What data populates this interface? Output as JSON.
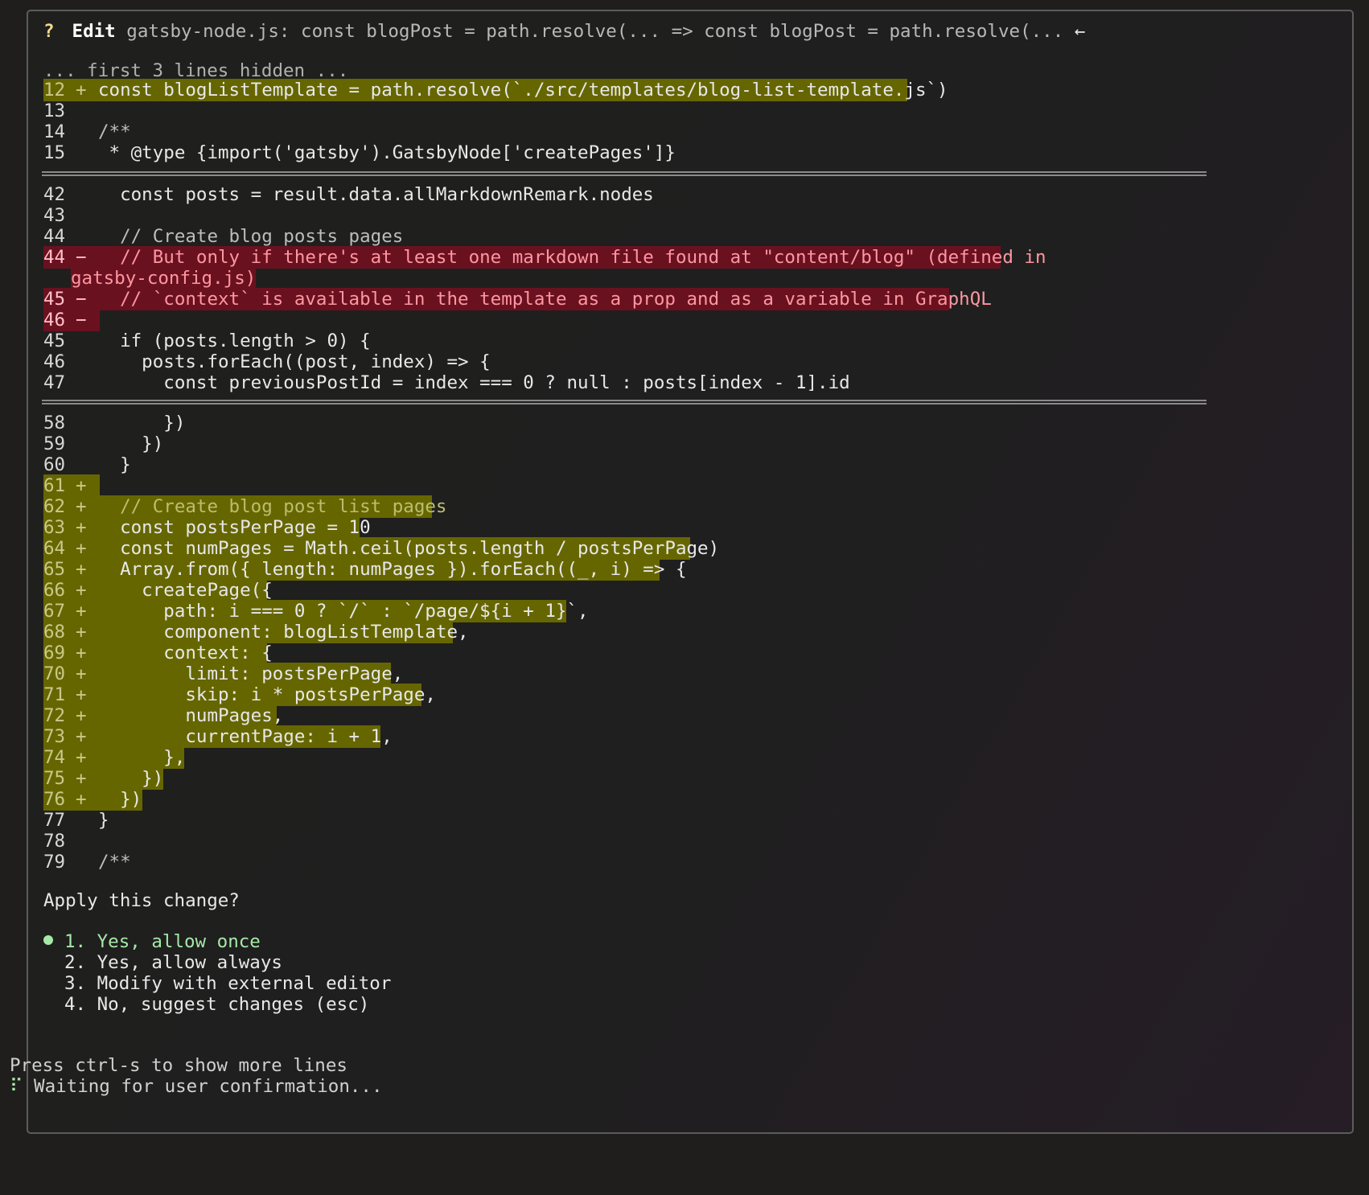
{
  "header": {
    "question_mark": "?",
    "action": "Edit",
    "description": "gatsby-node.js: const blogPost = path.resolve(... => const blogPost = path.resolve(...",
    "arrow": "←"
  },
  "diff": {
    "hidden_note": "... first 3 lines hidden ...",
    "hunk1": [
      {
        "num": "12",
        "mark": "+",
        "text": "const blogListTemplate = path.resolve(`./src/templates/blog-list-template.js`)",
        "kind": "add"
      },
      {
        "num": "13",
        "mark": "",
        "text": "",
        "kind": "ctx"
      },
      {
        "num": "14",
        "mark": "",
        "text": "/**",
        "kind": "ctx"
      },
      {
        "num": "15",
        "mark": "",
        "text": " * @type {import('gatsby').GatsbyNode['createPages']}",
        "kind": "ctx"
      }
    ],
    "hunk2": [
      {
        "num": "42",
        "mark": "",
        "text": "  const posts = result.data.allMarkdownRemark.nodes",
        "kind": "ctx"
      },
      {
        "num": "43",
        "mark": "",
        "text": "",
        "kind": "ctx"
      },
      {
        "num": "44",
        "mark": "",
        "text": "  // Create blog posts pages",
        "kind": "ctx"
      },
      {
        "num": "44",
        "mark": "−",
        "text": "  // But only if there's at least one markdown file found at \"content/blog\" (defined in",
        "kind": "del"
      },
      {
        "num": "",
        "mark": "",
        "text": "gatsby-config.js)",
        "kind": "delwrap"
      },
      {
        "num": "45",
        "mark": "−",
        "text": "  // `context` is available in the template as a prop and as a variable in GraphQL",
        "kind": "del"
      },
      {
        "num": "46",
        "mark": "−",
        "text": "",
        "kind": "del"
      },
      {
        "num": "45",
        "mark": "",
        "text": "  if (posts.length > 0) {",
        "kind": "ctx"
      },
      {
        "num": "46",
        "mark": "",
        "text": "    posts.forEach((post, index) => {",
        "kind": "ctx"
      },
      {
        "num": "47",
        "mark": "",
        "text": "      const previousPostId = index === 0 ? null : posts[index - 1].id",
        "kind": "ctx"
      }
    ],
    "hunk3": [
      {
        "num": "58",
        "mark": "",
        "text": "      })",
        "kind": "ctx"
      },
      {
        "num": "59",
        "mark": "",
        "text": "    })",
        "kind": "ctx"
      },
      {
        "num": "60",
        "mark": "",
        "text": "  }",
        "kind": "ctx"
      },
      {
        "num": "61",
        "mark": "+",
        "text": "",
        "kind": "add"
      },
      {
        "num": "62",
        "mark": "+",
        "text": "  // Create blog post list pages",
        "kind": "add"
      },
      {
        "num": "63",
        "mark": "+",
        "text": "  const postsPerPage = 10",
        "kind": "add"
      },
      {
        "num": "64",
        "mark": "+",
        "text": "  const numPages = Math.ceil(posts.length / postsPerPage)",
        "kind": "add"
      },
      {
        "num": "65",
        "mark": "+",
        "text": "  Array.from({ length: numPages }).forEach((_, i) => {",
        "kind": "add"
      },
      {
        "num": "66",
        "mark": "+",
        "text": "    createPage({",
        "kind": "add"
      },
      {
        "num": "67",
        "mark": "+",
        "text": "      path: i === 0 ? `/` : `/page/${i + 1}`,",
        "kind": "add"
      },
      {
        "num": "68",
        "mark": "+",
        "text": "      component: blogListTemplate,",
        "kind": "add"
      },
      {
        "num": "69",
        "mark": "+",
        "text": "      context: {",
        "kind": "add"
      },
      {
        "num": "70",
        "mark": "+",
        "text": "        limit: postsPerPage,",
        "kind": "add"
      },
      {
        "num": "71",
        "mark": "+",
        "text": "        skip: i * postsPerPage,",
        "kind": "add"
      },
      {
        "num": "72",
        "mark": "+",
        "text": "        numPages,",
        "kind": "add"
      },
      {
        "num": "73",
        "mark": "+",
        "text": "        currentPage: i + 1,",
        "kind": "add"
      },
      {
        "num": "74",
        "mark": "+",
        "text": "      },",
        "kind": "add"
      },
      {
        "num": "75",
        "mark": "+",
        "text": "    })",
        "kind": "add"
      },
      {
        "num": "76",
        "mark": "+",
        "text": "  })",
        "kind": "add"
      },
      {
        "num": "77",
        "mark": "",
        "text": "}",
        "kind": "ctx"
      },
      {
        "num": "78",
        "mark": "",
        "text": "",
        "kind": "ctx"
      },
      {
        "num": "79",
        "mark": "",
        "text": "/**",
        "kind": "ctx"
      }
    ]
  },
  "prompt": {
    "question": "Apply this change?",
    "options": [
      {
        "label": "1. Yes, allow once",
        "selected": true
      },
      {
        "label": "2. Yes, allow always",
        "selected": false
      },
      {
        "label": "3. Modify with external editor",
        "selected": false
      },
      {
        "label": "4. No, suggest changes (esc)",
        "selected": false
      }
    ]
  },
  "footer": {
    "hint": "Press ctrl-s to show more lines",
    "spinner": "⠏",
    "status": "Waiting for user confirmation..."
  },
  "colors": {
    "added_bg": "#666600",
    "removed_bg": "#6a1120",
    "selected": "#a6e8a6"
  }
}
